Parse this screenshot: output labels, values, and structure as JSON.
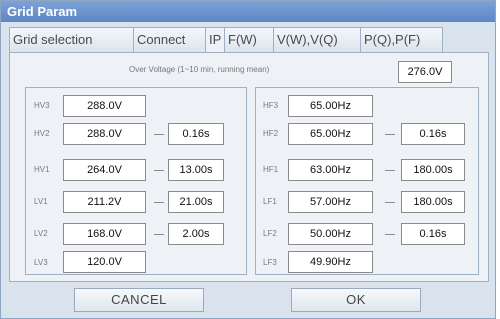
{
  "window": {
    "title": "Grid Param"
  },
  "tabs": [
    {
      "label": "Grid selection"
    },
    {
      "label": "Connect"
    },
    {
      "label": "IP"
    },
    {
      "label": "F(W)"
    },
    {
      "label": "V(W),V(Q)"
    },
    {
      "label": "P(Q),P(F)"
    }
  ],
  "over_voltage": {
    "label": "Over Voltage (1~10 min, running mean)",
    "value": "276.0V"
  },
  "voltage": {
    "rows": [
      {
        "label": "HV3",
        "value": "288.0V",
        "time": ""
      },
      {
        "label": "HV2",
        "value": "288.0V",
        "time": "0.16s"
      },
      {
        "label": "HV1",
        "value": "264.0V",
        "time": "13.00s"
      },
      {
        "label": "LV1",
        "value": "211.2V",
        "time": "21.00s"
      },
      {
        "label": "LV2",
        "value": "168.0V",
        "time": "2.00s"
      },
      {
        "label": "LV3",
        "value": "120.0V",
        "time": ""
      }
    ]
  },
  "frequency": {
    "rows": [
      {
        "label": "HF3",
        "value": "65.00Hz",
        "time": ""
      },
      {
        "label": "HF2",
        "value": "65.00Hz",
        "time": "0.16s"
      },
      {
        "label": "HF1",
        "value": "63.00Hz",
        "time": "180.00s"
      },
      {
        "label": "LF1",
        "value": "57.00Hz",
        "time": "180.00s"
      },
      {
        "label": "LF2",
        "value": "50.00Hz",
        "time": "0.16s"
      },
      {
        "label": "LF3",
        "value": "49.90Hz",
        "time": ""
      }
    ]
  },
  "buttons": {
    "cancel": "CANCEL",
    "ok": "OK"
  }
}
